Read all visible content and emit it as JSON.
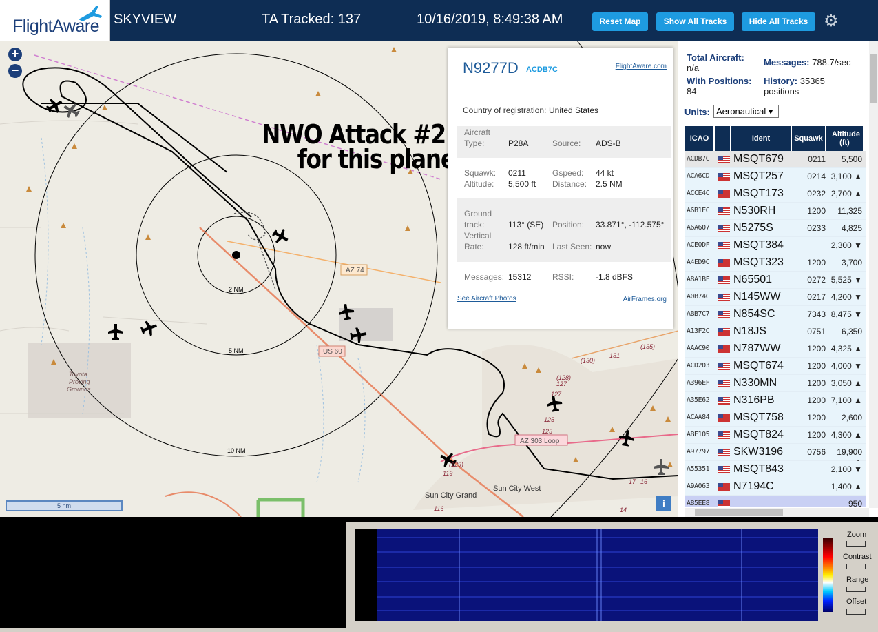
{
  "header": {
    "logo_text": "FlightAware",
    "app_name": "SKYVIEW",
    "tracked": "TA Tracked: 137",
    "datetime": "10/16/2019, 8:49:38 AM",
    "reset_map": "Reset Map",
    "show_all_tracks": "Show All Tracks",
    "hide_all_tracks": "Hide All Tracks"
  },
  "map": {
    "zoom_in": "+",
    "zoom_out": "−",
    "annotation_line1": "NWO Attack #2",
    "annotation_line2": "for this plane",
    "range_labels": [
      "2 NM",
      "5 NM",
      "10 NM"
    ],
    "road_labels": [
      "AZ 74",
      "US 60",
      "AZ 303 Loop"
    ],
    "place_labels": [
      "Toyota Proving Grounds",
      "Sun City Grand",
      "Sun City West"
    ],
    "number_labels": [
      "(128)",
      "127",
      "127",
      "125",
      "125",
      "(130)",
      "131",
      "(135)",
      "119",
      "116",
      "17",
      "16",
      "14",
      "(129)"
    ],
    "scale": "5 nm",
    "info_button": "i"
  },
  "popup": {
    "registration": "N9277D",
    "icao": "ACDB7C",
    "flightaware_link": "FlightAware.com",
    "country_label": "Country of registration:",
    "country": "United States",
    "aircraft_type_label_1": "Aircraft",
    "aircraft_type_label_2": "Type:",
    "aircraft_type": "P28A",
    "source_label": "Source:",
    "source": "ADS-B",
    "squawk_label": "Squawk:",
    "squawk": "0211",
    "gspeed_label": "Gspeed:",
    "gspeed": "44 kt",
    "altitude_label": "Altitude:",
    "altitude": "5,500 ft",
    "distance_label": "Distance:",
    "distance": "2.5 NM",
    "ground_track_label_1": "Ground",
    "ground_track_label_2": "track:",
    "ground_track": "113° (SE)",
    "position_label": "Position:",
    "position": "33.871°, -112.575°",
    "vertical_rate_label_1": "Vertical",
    "vertical_rate_label_2": "Rate:",
    "vertical_rate": "128 ft/min",
    "last_seen_label": "Last Seen:",
    "last_seen": "now",
    "messages_label": "Messages:",
    "messages": "15312",
    "rssi_label": "RSSI:",
    "rssi": "-1.8 dBFS",
    "photos_link": "See Aircraft Photos",
    "airframes_link": "AirFrames.org"
  },
  "sidebar": {
    "total_aircraft_label": "Total Aircraft:",
    "total_aircraft": "n/a",
    "messages_label": "Messages:",
    "messages": "788.7/sec",
    "with_positions_label": "With Positions:",
    "with_positions": "84",
    "history_label": "History:",
    "history": "35365",
    "history_unit": "positions",
    "units_label": "Units:",
    "units_value": "Aeronautical ▾",
    "columns": [
      "ICAO",
      "",
      "Ident",
      "Squawk",
      "Altitude (ft)"
    ],
    "rows": [
      {
        "icao": "ACDB7C",
        "ident": "MSQT679",
        "squawk": "0211",
        "alt": "5,500"
      },
      {
        "icao": "ACA6CD",
        "ident": "MSQT257",
        "squawk": "0214",
        "alt": "3,100 ▲"
      },
      {
        "icao": "ACCE4C",
        "ident": "MSQT173",
        "squawk": "0232",
        "alt": "2,700 ▲"
      },
      {
        "icao": "A6B1EC",
        "ident": "N530RH",
        "squawk": "1200",
        "alt": "11,325"
      },
      {
        "icao": "A6A607",
        "ident": "N5275S",
        "squawk": "0233",
        "alt": "4,825"
      },
      {
        "icao": "ACE0DF",
        "ident": "MSQT384",
        "squawk": "",
        "alt": "2,300 ▼"
      },
      {
        "icao": "A4ED9C",
        "ident": "MSQT323",
        "squawk": "1200",
        "alt": "3,700"
      },
      {
        "icao": "A8A1BF",
        "ident": "N65501",
        "squawk": "0272",
        "alt": "5,525 ▼"
      },
      {
        "icao": "A0B74C",
        "ident": "N145WW",
        "squawk": "0217",
        "alt": "4,200 ▼"
      },
      {
        "icao": "ABB7C7",
        "ident": "N854SC",
        "squawk": "7343",
        "alt": "8,475 ▼"
      },
      {
        "icao": "A13F2C",
        "ident": "N18JS",
        "squawk": "0751",
        "alt": "6,350"
      },
      {
        "icao": "AAAC90",
        "ident": "N787WW",
        "squawk": "1200",
        "alt": "4,325 ▲"
      },
      {
        "icao": "ACD203",
        "ident": "MSQT674",
        "squawk": "1200",
        "alt": "4,000 ▼"
      },
      {
        "icao": "A396EF",
        "ident": "N330MN",
        "squawk": "1200",
        "alt": "3,050 ▲"
      },
      {
        "icao": "A35E62",
        "ident": "N316PB",
        "squawk": "1200",
        "alt": "7,100 ▲"
      },
      {
        "icao": "ACAA84",
        "ident": "MSQT758",
        "squawk": "1200",
        "alt": "2,600"
      },
      {
        "icao": "ABE105",
        "ident": "MSQT824",
        "squawk": "1200",
        "alt": "4,300 ▲"
      },
      {
        "icao": "A97797",
        "ident": "SKW3196",
        "squawk": "0756",
        "alt": "19,900 ▲"
      },
      {
        "icao": "A55351",
        "ident": "MSQT843",
        "squawk": "",
        "alt": "2,100 ▼"
      },
      {
        "icao": "A9A063",
        "ident": "N7194C",
        "squawk": "",
        "alt": "1,400 ▲"
      },
      {
        "icao": "A85EE8",
        "ident": "",
        "squawk": "",
        "alt": "950"
      }
    ]
  },
  "spectrum": {
    "zoom": "Zoom",
    "contrast": "Contrast",
    "range": "Range",
    "offset": "Offset"
  }
}
